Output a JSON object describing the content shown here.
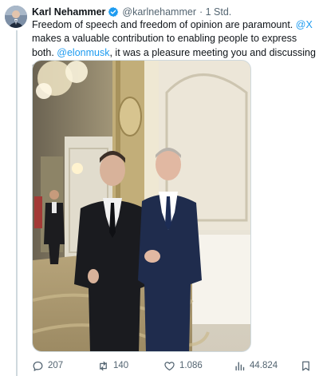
{
  "tweet": {
    "author": {
      "name": "Karl Nehammer",
      "handle": "@karlnehammer",
      "time": "· 1 Std.",
      "verified": true
    },
    "text": {
      "part1": "Freedom of speech and freedom of opinion are paramount. ",
      "mention1": "@X",
      "part2": " makes a valuable contribution to enabling people to express both. ",
      "mention2": "@elonmusk",
      "part3": ", it was a pleasure meeting you and discussing economic policy issues."
    },
    "actions": {
      "replies": "207",
      "reposts": "140",
      "likes": "1.086",
      "views": "44.824"
    }
  },
  "icons": {
    "verified": "verified-badge-icon",
    "reply": "reply-icon",
    "repost": "repost-icon",
    "like": "heart-icon",
    "views": "views-chart-icon",
    "bookmark": "bookmark-icon"
  },
  "colors": {
    "accent": "#1d9bf0",
    "text": "#0f1419",
    "secondary": "#536471",
    "thread_line": "#cfd9de"
  }
}
